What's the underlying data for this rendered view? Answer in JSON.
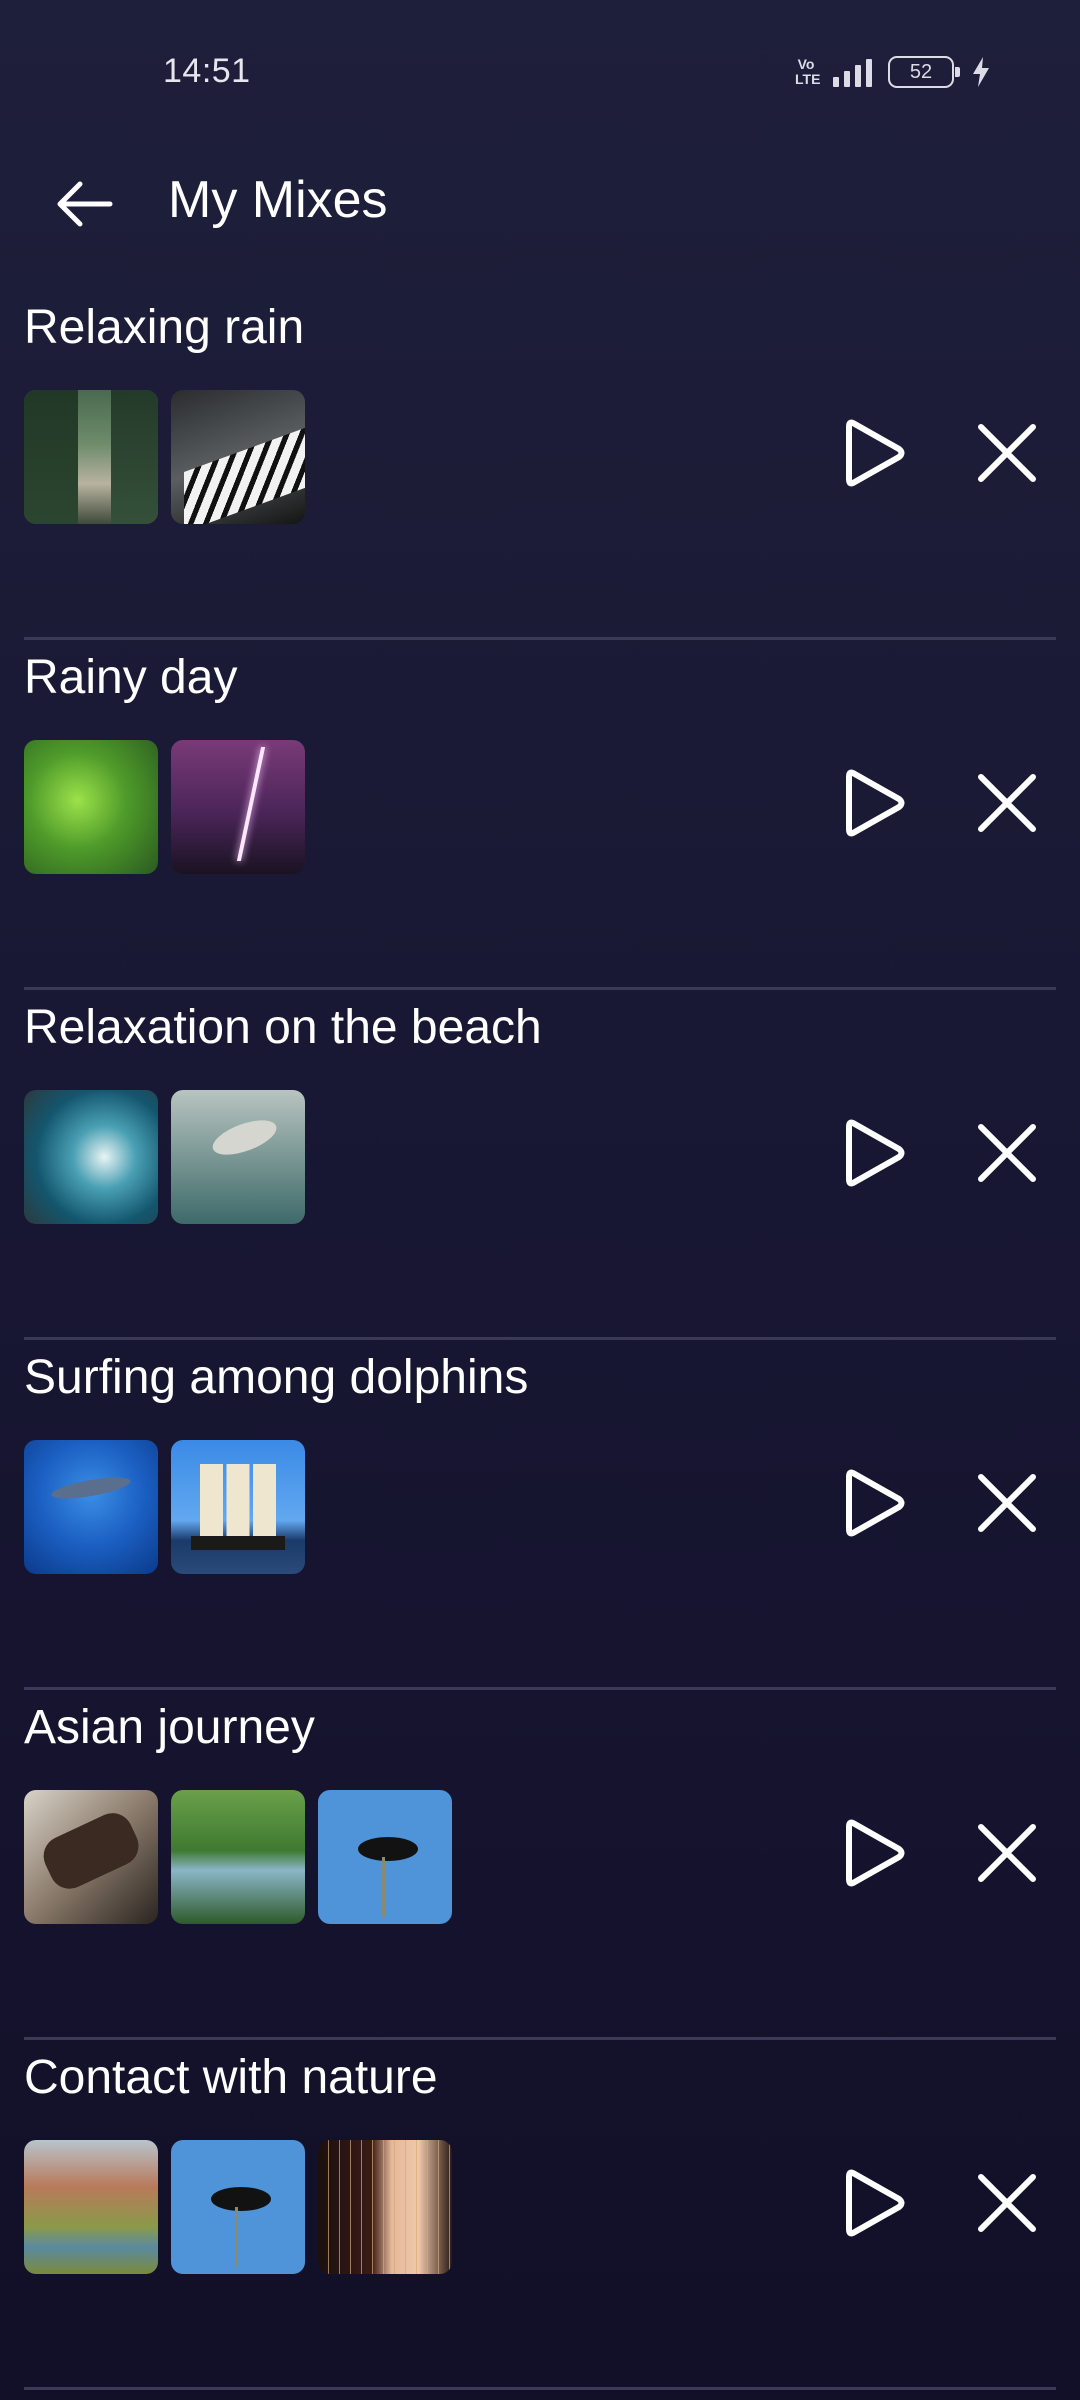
{
  "status_bar": {
    "time": "14:51",
    "network_label": "Vo LTE",
    "battery_level": "52"
  },
  "header": {
    "title": "My Mixes",
    "back_icon": "arrow-left-icon"
  },
  "mixes": [
    {
      "title": "Relaxing rain",
      "thumbnails": [
        "forest-road",
        "piano-hands"
      ]
    },
    {
      "title": "Rainy day",
      "thumbnails": [
        "wet-leaves",
        "lightning"
      ]
    },
    {
      "title": "Relaxation on the beach",
      "thumbnails": [
        "ocean-waves",
        "seagulls"
      ]
    },
    {
      "title": "Surfing among dolphins",
      "thumbnails": [
        "dolphins",
        "sailing-ship"
      ]
    },
    {
      "title": "Asian journey",
      "thumbnails": [
        "zither",
        "forest-stream",
        "blackbird"
      ]
    },
    {
      "title": "Contact with nature",
      "thumbnails": [
        "canyon-river",
        "blackbird",
        "harp-hands"
      ]
    }
  ],
  "actions": {
    "play_icon": "play-icon",
    "remove_icon": "close-icon"
  },
  "colors": {
    "background_top": "#1e1f3a",
    "background_bottom": "#120f28",
    "divider": "#3a3a58",
    "text": "#ffffff"
  }
}
